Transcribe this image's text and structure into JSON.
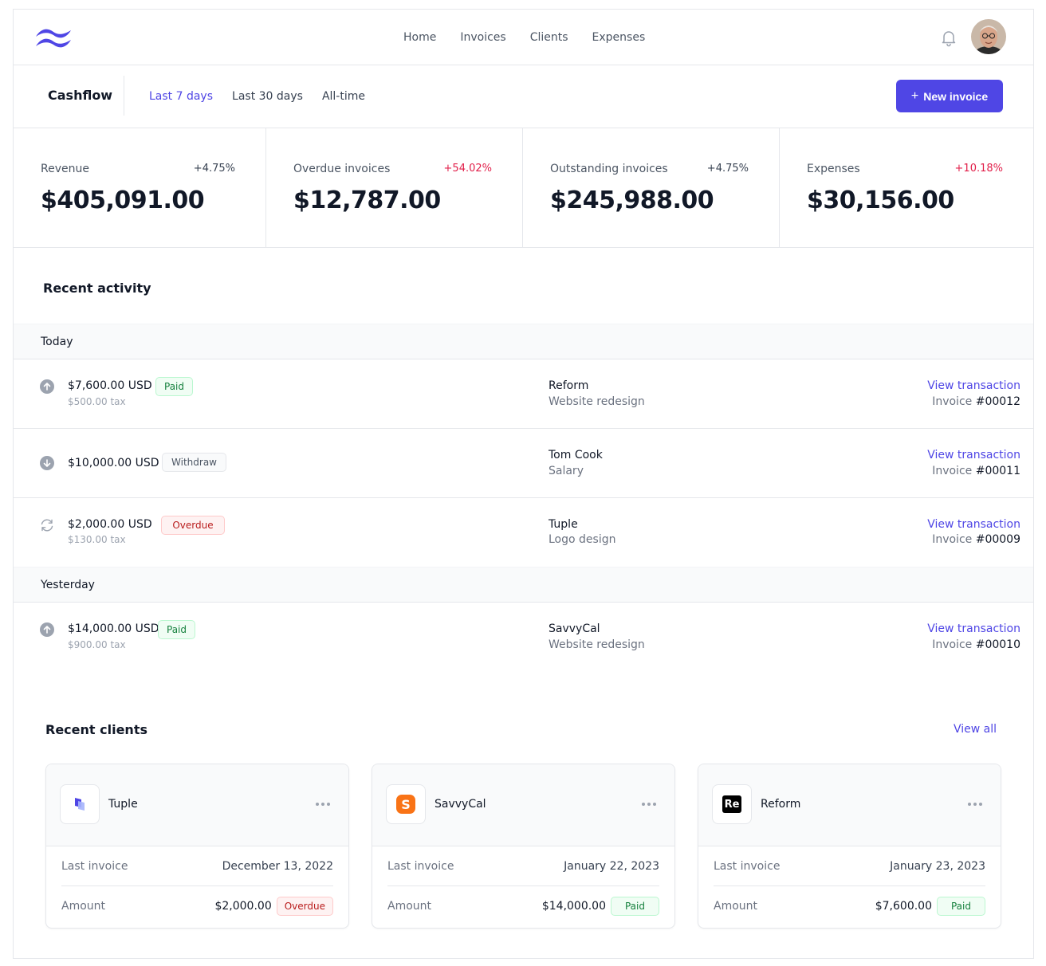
{
  "nav": {
    "links": [
      "Home",
      "Invoices",
      "Clients",
      "Expenses"
    ]
  },
  "cashflow": {
    "title": "Cashflow",
    "ranges": [
      "Last 7 days",
      "Last 30 days",
      "All-time"
    ],
    "active_range": "Last 7 days",
    "new_invoice_label": "New invoice"
  },
  "stats": [
    {
      "label": "Revenue",
      "change": "+4.75%",
      "value": "$405,091.00",
      "change_color": "#374151"
    },
    {
      "label": "Overdue invoices",
      "change": "+54.02%",
      "value": "$12,787.00",
      "change_color": "#e11d48"
    },
    {
      "label": "Outstanding invoices",
      "change": "+4.75%",
      "value": "$245,988.00",
      "change_color": "#374151"
    },
    {
      "label": "Expenses",
      "change": "+10.18%",
      "value": "$30,156.00",
      "change_color": "#e11d48"
    }
  ],
  "activity": {
    "title": "Recent activity",
    "groups": [
      {
        "label": "Today",
        "rows": [
          {
            "icon": "arrow-up-circle-icon",
            "amount": "$7,600.00 USD",
            "tax": "$500.00 tax",
            "status": "Paid",
            "client": "Reform",
            "description": "Website redesign",
            "link": "View transaction",
            "invoice_label": "Invoice",
            "invoice_number": "#00012"
          },
          {
            "icon": "arrow-down-circle-icon",
            "amount": "$10,000.00 USD",
            "tax": "",
            "status": "Withdraw",
            "client": "Tom Cook",
            "description": "Salary",
            "link": "View transaction",
            "invoice_label": "Invoice",
            "invoice_number": "#00011"
          },
          {
            "icon": "refresh-icon",
            "amount": "$2,000.00 USD",
            "tax": "$130.00 tax",
            "status": "Overdue",
            "client": "Tuple",
            "description": "Logo design",
            "link": "View transaction",
            "invoice_label": "Invoice",
            "invoice_number": "#00009"
          }
        ]
      },
      {
        "label": "Yesterday",
        "rows": [
          {
            "icon": "arrow-up-circle-icon",
            "amount": "$14,000.00 USD",
            "tax": "$900.00 tax",
            "status": "Paid",
            "client": "SavvyCal",
            "description": "Website redesign",
            "link": "View transaction",
            "invoice_label": "Invoice",
            "invoice_number": "#00010"
          }
        ]
      }
    ]
  },
  "clients": {
    "title": "Recent clients",
    "view_all": "View all",
    "last_invoice_label": "Last invoice",
    "amount_label": "Amount",
    "cards": [
      {
        "name": "Tuple",
        "logo": "tuple-logo",
        "last_invoice": "December 13, 2022",
        "amount": "$2,000.00",
        "status": "Overdue"
      },
      {
        "name": "SavvyCal",
        "logo": "savvycal-logo",
        "last_invoice": "January 22, 2023",
        "amount": "$14,000.00",
        "status": "Paid"
      },
      {
        "name": "Reform",
        "logo": "reform-logo",
        "logo_text": "Re",
        "last_invoice": "January 23, 2023",
        "amount": "$7,600.00",
        "status": "Paid"
      }
    ]
  },
  "colors": {
    "accent": "#4f46e5",
    "negative": "#e11d48",
    "paid": "#15803d",
    "overdue": "#b91c1c"
  }
}
